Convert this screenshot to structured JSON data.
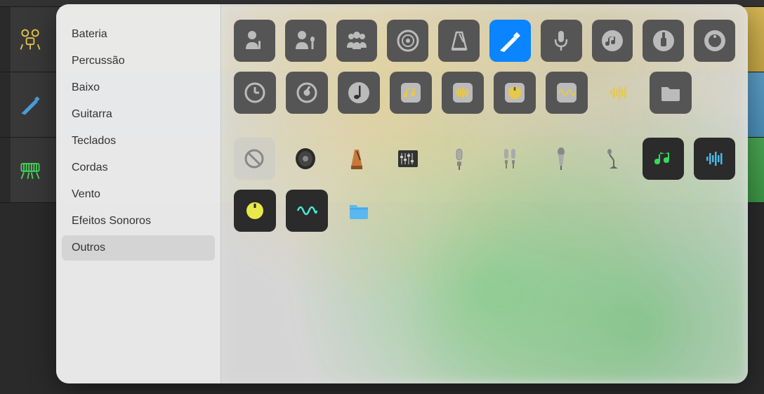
{
  "sidebar": {
    "items": [
      {
        "label": "Bateria"
      },
      {
        "label": "Percussão"
      },
      {
        "label": "Baixo"
      },
      {
        "label": "Guitarra"
      },
      {
        "label": "Teclados"
      },
      {
        "label": "Cordas"
      },
      {
        "label": "Vento"
      },
      {
        "label": "Efeitos Sonoros"
      },
      {
        "label": "Outros"
      }
    ],
    "selected_index": 8
  },
  "icon_grid": {
    "rows": [
      [
        {
          "name": "vocal-solo-icon",
          "style": "gray"
        },
        {
          "name": "vocal-mic-icon",
          "style": "gray"
        },
        {
          "name": "group-icon",
          "style": "gray"
        },
        {
          "name": "speaker-cone-icon",
          "style": "gray"
        },
        {
          "name": "metronome-icon",
          "style": "gray"
        },
        {
          "name": "pencil-icon",
          "style": "selected"
        },
        {
          "name": "microphone-icon",
          "style": "gray"
        },
        {
          "name": "music-note-circle-icon",
          "style": "gray"
        },
        {
          "name": "jack-plug-icon",
          "style": "gray"
        },
        {
          "name": "knob-circle-icon",
          "style": "gray"
        }
      ],
      [
        {
          "name": "clock-icon",
          "style": "gray"
        },
        {
          "name": "dial-icon",
          "style": "gray"
        },
        {
          "name": "note-dark-icon",
          "style": "gray"
        },
        {
          "name": "music-square-icon",
          "style": "gray"
        },
        {
          "name": "waveform-bars-icon",
          "style": "gray"
        },
        {
          "name": "knob-dark-icon",
          "style": "gray"
        },
        {
          "name": "waveform-dark-icon",
          "style": "gray"
        },
        {
          "name": "waveform-light-icon",
          "style": "gray"
        },
        {
          "name": "folder-icon",
          "style": "gray"
        }
      ],
      [
        {
          "name": "disabled-icon",
          "style": "disabled"
        },
        {
          "name": "speaker-real-icon",
          "style": "transparent"
        },
        {
          "name": "metronome-real-icon",
          "style": "transparent"
        },
        {
          "name": "mixer-real-icon",
          "style": "transparent"
        },
        {
          "name": "condenser-mic-icon",
          "style": "transparent"
        },
        {
          "name": "stereo-mics-icon",
          "style": "transparent"
        },
        {
          "name": "dynamic-mic-icon",
          "style": "transparent"
        },
        {
          "name": "mic-stand-icon",
          "style": "transparent"
        },
        {
          "name": "music-green-icon",
          "style": "dark"
        },
        {
          "name": "wave-blue-icon",
          "style": "dark"
        }
      ],
      [
        {
          "name": "knob-yellow-icon",
          "style": "dark"
        },
        {
          "name": "wave-teal-icon",
          "style": "dark"
        },
        {
          "name": "folder-blue-icon",
          "style": "transparent"
        }
      ]
    ]
  },
  "tracks": [
    {
      "color": "purple",
      "icon": "none"
    },
    {
      "color": "yellow",
      "icon": "drums"
    },
    {
      "color": "blue",
      "icon": "pencil"
    },
    {
      "color": "green",
      "icon": "keyboard"
    }
  ]
}
